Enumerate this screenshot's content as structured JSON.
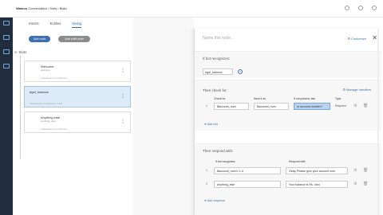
{
  "header": {
    "brand": "Watson",
    "product": "Conversation",
    "crumb1": "Slots",
    "crumb2": "Build"
  },
  "tabs": [
    {
      "label": "Intents"
    },
    {
      "label": "Entities"
    },
    {
      "label": "Dialog"
    }
  ],
  "actions": {
    "add_node": "Add node",
    "add_child": "Add child node"
  },
  "tree": {
    "label": "Slots",
    "nodes": [
      {
        "title": "Welcome",
        "sub": "welcome",
        "meta": "1 Responses / 0 Context set"
      },
      {
        "title": "#get_balance",
        "sub": "",
        "meta": "2 Responses / 0 Context set / 1 slot"
      },
      {
        "title": "Anything else",
        "sub": "anything_else",
        "meta": "1 Responses / 0 Context set"
      }
    ]
  },
  "panel": {
    "node_name_placeholder": "Name this node...",
    "customize": "Customize",
    "if_bot_recognizes": "If bot recognizes:",
    "condition": "#get_balance",
    "then_check_for": "Then check for:",
    "manage_handlers": "Manage handlers",
    "slot_headers": {
      "check_for": "Check for",
      "save_it_as": "Save it as",
      "if_not_present": "If not present, ask",
      "type": "Type"
    },
    "slot_row": {
      "check_for": "$account_num",
      "save_it_as": "$account_num",
      "if_not_present": "ur account number?",
      "type": "Required"
    },
    "add_slot": "Add slot",
    "then_respond_with": "Then respond with:",
    "response_headers": {
      "if_bot_recognizes": "If bot recognizes",
      "respond_with": "Respond with"
    },
    "responses": [
      {
        "num": "1",
        "condition": "$account_num!=-1 #",
        "response": "Okay. Please give your account num"
      },
      {
        "num": "2",
        "condition": "anything_else",
        "response": "Your balance is Rs. xxxx"
      }
    ],
    "add_response": "Add response"
  }
}
